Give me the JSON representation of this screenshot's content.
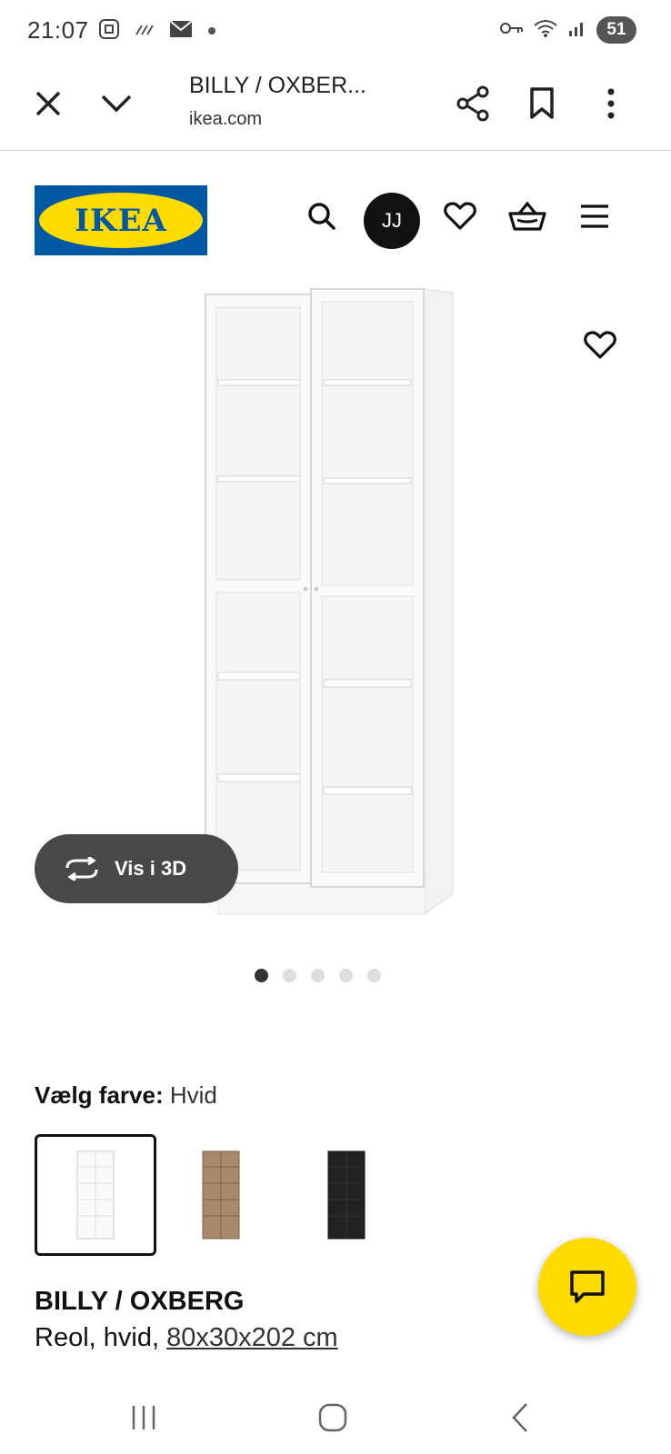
{
  "status_bar": {
    "time": "21:07",
    "battery": "51",
    "icons_left": [
      "screenshot-icon",
      "data-icon",
      "mail-icon",
      "dot-icon"
    ],
    "icons_right": [
      "key-icon",
      "wifi-icon",
      "signal-icon"
    ]
  },
  "browser": {
    "title": "BILLY / OXBER...",
    "url": "ikea.com",
    "icons": [
      "close-icon",
      "chevron-down-icon",
      "share-icon",
      "bookmark-icon",
      "more-icon"
    ]
  },
  "header": {
    "logo_text": "IKEA",
    "avatar_initials": "JJ",
    "icons": [
      "search-icon",
      "heart-icon",
      "basket-icon",
      "menu-icon"
    ]
  },
  "gallery": {
    "vis3d_label": "Vis i 3D",
    "image_count": 5,
    "active_index": 0
  },
  "color_select": {
    "label": "Vælg farve:",
    "value": "Hvid",
    "swatches": [
      {
        "color": "#f5f5f3",
        "selected": true
      },
      {
        "color": "#9a7c5f",
        "selected": false
      },
      {
        "color": "#1e1e1e",
        "selected": false
      }
    ]
  },
  "product": {
    "name": "BILLY / OXBERG",
    "desc": "Reol, hvid,",
    "dims": "80x30x202 cm"
  },
  "colors": {
    "ikea_blue": "#0058a3",
    "ikea_yellow": "#ffdb00"
  }
}
